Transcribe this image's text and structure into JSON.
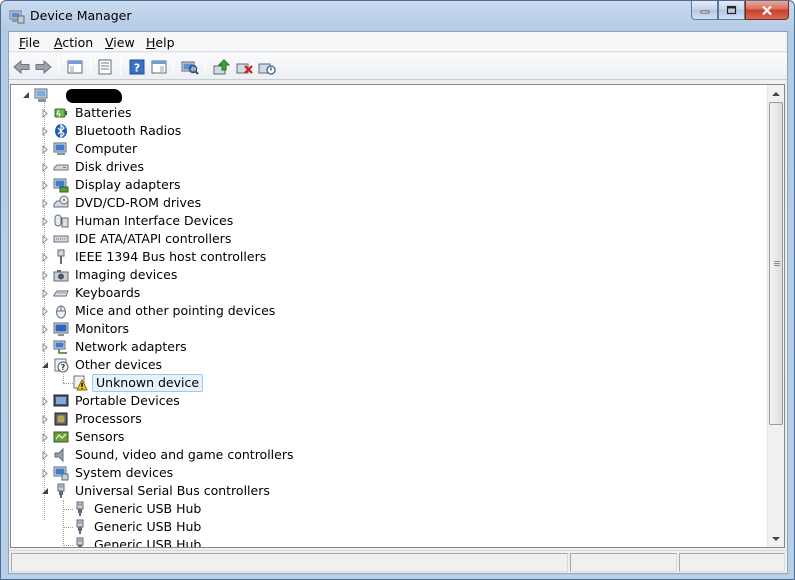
{
  "window": {
    "title": "Device Manager",
    "controls": [
      "minimize",
      "maximize",
      "close"
    ]
  },
  "menubar": {
    "items": [
      {
        "label": "File",
        "mnemonic": "F",
        "rest": "ile"
      },
      {
        "label": "Action",
        "mnemonic": "A",
        "rest": "ction"
      },
      {
        "label": "View",
        "mnemonic": "V",
        "rest": "iew"
      },
      {
        "label": "Help",
        "mnemonic": "H",
        "rest": "elp"
      }
    ]
  },
  "toolbar": {
    "buttons": [
      "back-icon",
      "forward-icon",
      "show-hide-console-tree-icon",
      "properties-icon",
      "help-icon",
      "action-pane-icon",
      "scan-hardware-icon",
      "update-driver-icon",
      "uninstall-icon",
      "disable-icon"
    ]
  },
  "tree": {
    "root_label": "",
    "categories": [
      {
        "label": "Batteries",
        "icon": "battery-icon",
        "expanded": false
      },
      {
        "label": "Bluetooth Radios",
        "icon": "bluetooth-icon",
        "expanded": false
      },
      {
        "label": "Computer",
        "icon": "computer-icon",
        "expanded": false
      },
      {
        "label": "Disk drives",
        "icon": "disk-drive-icon",
        "expanded": false
      },
      {
        "label": "Display adapters",
        "icon": "display-adapter-icon",
        "expanded": false
      },
      {
        "label": "DVD/CD-ROM drives",
        "icon": "dvd-drive-icon",
        "expanded": false
      },
      {
        "label": "Human Interface Devices",
        "icon": "hid-icon",
        "expanded": false
      },
      {
        "label": "IDE ATA/ATAPI controllers",
        "icon": "ide-controller-icon",
        "expanded": false
      },
      {
        "label": "IEEE 1394 Bus host controllers",
        "icon": "ieee1394-icon",
        "expanded": false
      },
      {
        "label": "Imaging devices",
        "icon": "camera-icon",
        "expanded": false
      },
      {
        "label": "Keyboards",
        "icon": "keyboard-icon",
        "expanded": false
      },
      {
        "label": "Mice and other pointing devices",
        "icon": "mouse-icon",
        "expanded": false
      },
      {
        "label": "Monitors",
        "icon": "monitor-icon",
        "expanded": false
      },
      {
        "label": "Network adapters",
        "icon": "network-adapter-icon",
        "expanded": false
      },
      {
        "label": "Other devices",
        "icon": "unknown-device-icon",
        "expanded": true,
        "children": [
          {
            "label": "Unknown device",
            "icon": "warning-device-icon",
            "selected": true
          }
        ]
      },
      {
        "label": "Portable Devices",
        "icon": "portable-device-icon",
        "expanded": false
      },
      {
        "label": "Processors",
        "icon": "processor-icon",
        "expanded": false
      },
      {
        "label": "Sensors",
        "icon": "sensor-icon",
        "expanded": false
      },
      {
        "label": "Sound, video and game controllers",
        "icon": "speaker-icon",
        "expanded": false
      },
      {
        "label": "System devices",
        "icon": "system-device-icon",
        "expanded": false
      },
      {
        "label": "Universal Serial Bus controllers",
        "icon": "usb-icon",
        "expanded": true,
        "children": [
          {
            "label": "Generic USB Hub",
            "icon": "usb-icon"
          },
          {
            "label": "Generic USB Hub",
            "icon": "usb-icon"
          },
          {
            "label": "Generic USB Hub",
            "icon": "usb-icon"
          }
        ]
      }
    ]
  },
  "colors": {
    "selection_bg": "#e8f2fc",
    "selection_border": "#99c9ef",
    "frame": "#b9cfe8"
  }
}
